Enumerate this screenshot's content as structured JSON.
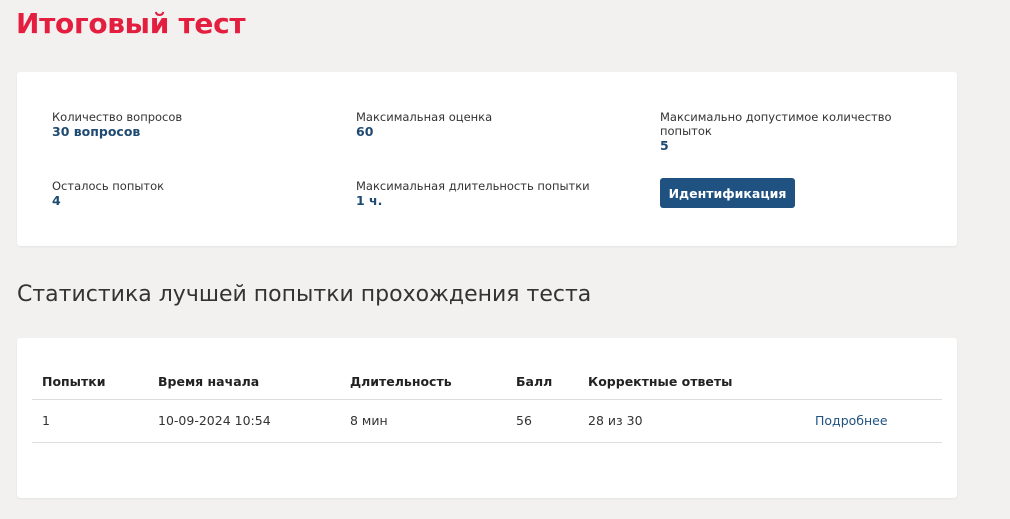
{
  "page": {
    "title": "Итоговый тест"
  },
  "info": {
    "questions_label": "Количество вопросов",
    "questions_value": "30 вопросов",
    "max_score_label": "Максимальная оценка",
    "max_score_value": "60",
    "max_attempts_label_line1": "Максимально допустимое количество",
    "max_attempts_label_line2": "попыток",
    "max_attempts_value": "5",
    "remaining_label": "Осталось попыток",
    "remaining_value": "4",
    "duration_label": "Максимальная длительность попытки",
    "duration_value": "1 ч.",
    "identify_button": "Идентификация"
  },
  "stats": {
    "title": "Статистика лучшей попытки прохождения теста",
    "headers": [
      "Попытки",
      "Время начала",
      "Длительность",
      "Балл",
      "Корректные ответы",
      ""
    ],
    "rows": [
      {
        "attempt": "1",
        "start_time": "10-09-2024 10:54",
        "duration": "8 мин",
        "score": "56",
        "correct": "28 из 30",
        "details": "Подробнее"
      }
    ]
  },
  "colors": {
    "title_red": "#e31e3f",
    "accent_blue": "#1f5281",
    "value_blue": "#1f4a72",
    "background": "#f2f1ef"
  }
}
